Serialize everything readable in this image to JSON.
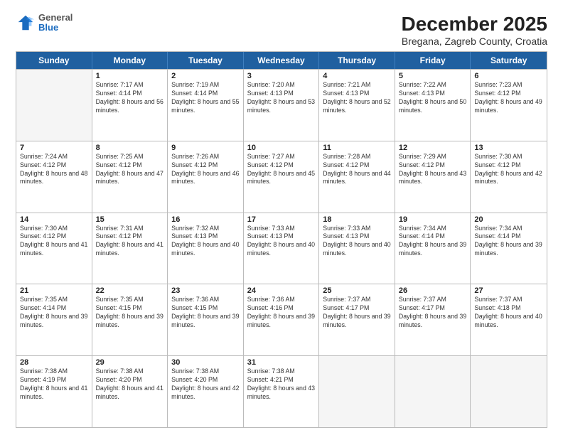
{
  "header": {
    "logo": {
      "general": "General",
      "blue": "Blue"
    },
    "title": "December 2025",
    "subtitle": "Bregana, Zagreb County, Croatia"
  },
  "days_of_week": [
    "Sunday",
    "Monday",
    "Tuesday",
    "Wednesday",
    "Thursday",
    "Friday",
    "Saturday"
  ],
  "weeks": [
    [
      {
        "day": null,
        "empty": true
      },
      {
        "day": "1",
        "sunrise": "Sunrise: 7:17 AM",
        "sunset": "Sunset: 4:14 PM",
        "daylight": "Daylight: 8 hours and 56 minutes."
      },
      {
        "day": "2",
        "sunrise": "Sunrise: 7:19 AM",
        "sunset": "Sunset: 4:14 PM",
        "daylight": "Daylight: 8 hours and 55 minutes."
      },
      {
        "day": "3",
        "sunrise": "Sunrise: 7:20 AM",
        "sunset": "Sunset: 4:13 PM",
        "daylight": "Daylight: 8 hours and 53 minutes."
      },
      {
        "day": "4",
        "sunrise": "Sunrise: 7:21 AM",
        "sunset": "Sunset: 4:13 PM",
        "daylight": "Daylight: 8 hours and 52 minutes."
      },
      {
        "day": "5",
        "sunrise": "Sunrise: 7:22 AM",
        "sunset": "Sunset: 4:13 PM",
        "daylight": "Daylight: 8 hours and 50 minutes."
      },
      {
        "day": "6",
        "sunrise": "Sunrise: 7:23 AM",
        "sunset": "Sunset: 4:12 PM",
        "daylight": "Daylight: 8 hours and 49 minutes."
      }
    ],
    [
      {
        "day": "7",
        "sunrise": "Sunrise: 7:24 AM",
        "sunset": "Sunset: 4:12 PM",
        "daylight": "Daylight: 8 hours and 48 minutes."
      },
      {
        "day": "8",
        "sunrise": "Sunrise: 7:25 AM",
        "sunset": "Sunset: 4:12 PM",
        "daylight": "Daylight: 8 hours and 47 minutes."
      },
      {
        "day": "9",
        "sunrise": "Sunrise: 7:26 AM",
        "sunset": "Sunset: 4:12 PM",
        "daylight": "Daylight: 8 hours and 46 minutes."
      },
      {
        "day": "10",
        "sunrise": "Sunrise: 7:27 AM",
        "sunset": "Sunset: 4:12 PM",
        "daylight": "Daylight: 8 hours and 45 minutes."
      },
      {
        "day": "11",
        "sunrise": "Sunrise: 7:28 AM",
        "sunset": "Sunset: 4:12 PM",
        "daylight": "Daylight: 8 hours and 44 minutes."
      },
      {
        "day": "12",
        "sunrise": "Sunrise: 7:29 AM",
        "sunset": "Sunset: 4:12 PM",
        "daylight": "Daylight: 8 hours and 43 minutes."
      },
      {
        "day": "13",
        "sunrise": "Sunrise: 7:30 AM",
        "sunset": "Sunset: 4:12 PM",
        "daylight": "Daylight: 8 hours and 42 minutes."
      }
    ],
    [
      {
        "day": "14",
        "sunrise": "Sunrise: 7:30 AM",
        "sunset": "Sunset: 4:12 PM",
        "daylight": "Daylight: 8 hours and 41 minutes."
      },
      {
        "day": "15",
        "sunrise": "Sunrise: 7:31 AM",
        "sunset": "Sunset: 4:12 PM",
        "daylight": "Daylight: 8 hours and 41 minutes."
      },
      {
        "day": "16",
        "sunrise": "Sunrise: 7:32 AM",
        "sunset": "Sunset: 4:13 PM",
        "daylight": "Daylight: 8 hours and 40 minutes."
      },
      {
        "day": "17",
        "sunrise": "Sunrise: 7:33 AM",
        "sunset": "Sunset: 4:13 PM",
        "daylight": "Daylight: 8 hours and 40 minutes."
      },
      {
        "day": "18",
        "sunrise": "Sunrise: 7:33 AM",
        "sunset": "Sunset: 4:13 PM",
        "daylight": "Daylight: 8 hours and 40 minutes."
      },
      {
        "day": "19",
        "sunrise": "Sunrise: 7:34 AM",
        "sunset": "Sunset: 4:14 PM",
        "daylight": "Daylight: 8 hours and 39 minutes."
      },
      {
        "day": "20",
        "sunrise": "Sunrise: 7:34 AM",
        "sunset": "Sunset: 4:14 PM",
        "daylight": "Daylight: 8 hours and 39 minutes."
      }
    ],
    [
      {
        "day": "21",
        "sunrise": "Sunrise: 7:35 AM",
        "sunset": "Sunset: 4:14 PM",
        "daylight": "Daylight: 8 hours and 39 minutes."
      },
      {
        "day": "22",
        "sunrise": "Sunrise: 7:35 AM",
        "sunset": "Sunset: 4:15 PM",
        "daylight": "Daylight: 8 hours and 39 minutes."
      },
      {
        "day": "23",
        "sunrise": "Sunrise: 7:36 AM",
        "sunset": "Sunset: 4:15 PM",
        "daylight": "Daylight: 8 hours and 39 minutes."
      },
      {
        "day": "24",
        "sunrise": "Sunrise: 7:36 AM",
        "sunset": "Sunset: 4:16 PM",
        "daylight": "Daylight: 8 hours and 39 minutes."
      },
      {
        "day": "25",
        "sunrise": "Sunrise: 7:37 AM",
        "sunset": "Sunset: 4:17 PM",
        "daylight": "Daylight: 8 hours and 39 minutes."
      },
      {
        "day": "26",
        "sunrise": "Sunrise: 7:37 AM",
        "sunset": "Sunset: 4:17 PM",
        "daylight": "Daylight: 8 hours and 39 minutes."
      },
      {
        "day": "27",
        "sunrise": "Sunrise: 7:37 AM",
        "sunset": "Sunset: 4:18 PM",
        "daylight": "Daylight: 8 hours and 40 minutes."
      }
    ],
    [
      {
        "day": "28",
        "sunrise": "Sunrise: 7:38 AM",
        "sunset": "Sunset: 4:19 PM",
        "daylight": "Daylight: 8 hours and 41 minutes."
      },
      {
        "day": "29",
        "sunrise": "Sunrise: 7:38 AM",
        "sunset": "Sunset: 4:20 PM",
        "daylight": "Daylight: 8 hours and 41 minutes."
      },
      {
        "day": "30",
        "sunrise": "Sunrise: 7:38 AM",
        "sunset": "Sunset: 4:20 PM",
        "daylight": "Daylight: 8 hours and 42 minutes."
      },
      {
        "day": "31",
        "sunrise": "Sunrise: 7:38 AM",
        "sunset": "Sunset: 4:21 PM",
        "daylight": "Daylight: 8 hours and 43 minutes."
      },
      {
        "day": null,
        "empty": true
      },
      {
        "day": null,
        "empty": true
      },
      {
        "day": null,
        "empty": true
      }
    ]
  ]
}
